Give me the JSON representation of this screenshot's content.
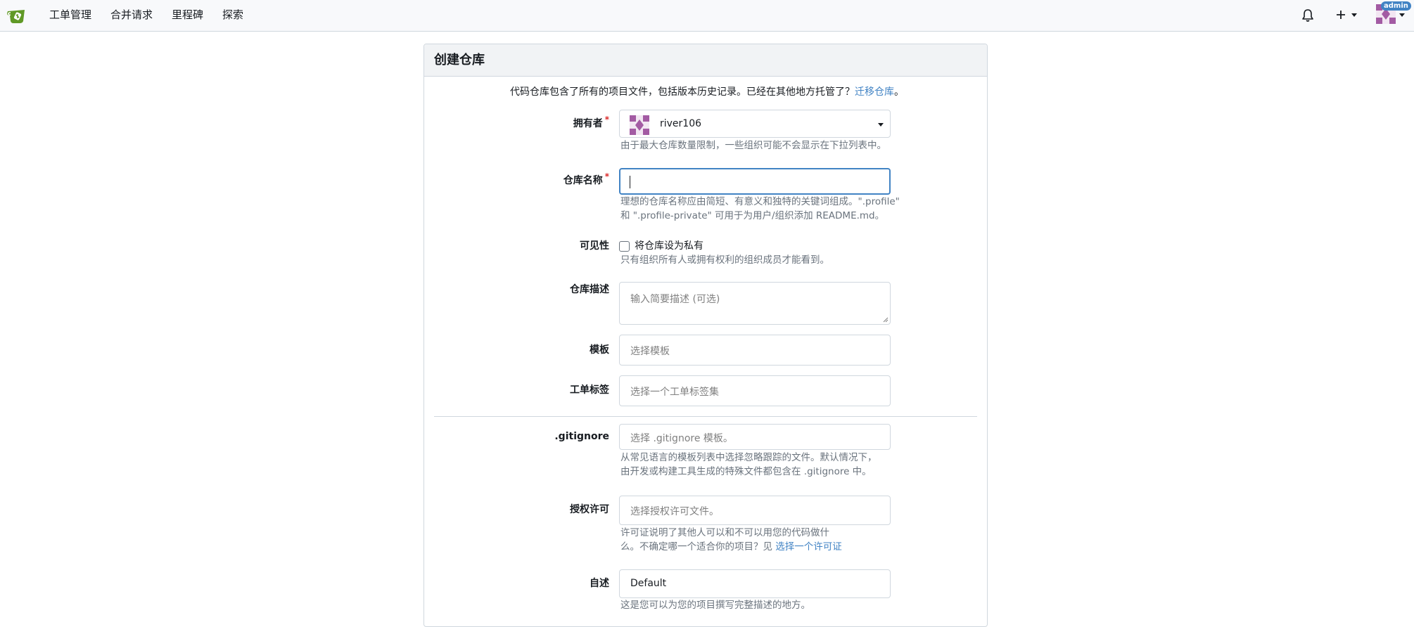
{
  "nav": {
    "items": [
      "工单管理",
      "合并请求",
      "里程碑",
      "探索"
    ],
    "admin_badge": "admin",
    "icons": [
      "bell-icon",
      "plus-icon",
      "avatar"
    ]
  },
  "card": {
    "title": "创建仓库",
    "intro_text": "代码仓库包含了所有的项目文件，包括版本历史记录。已经在其他地方托管了？",
    "intro_link": "迁移仓库",
    "intro_suffix": "。"
  },
  "form": {
    "owner": {
      "label": "拥有者",
      "value": "river106",
      "help": "由于最大仓库数量限制，一些组织可能不会显示在下拉列表中。"
    },
    "repo_name": {
      "label": "仓库名称",
      "value": "",
      "help_line1": "理想的仓库名称应由简短、有意义和独特的关键词组成。\".profile\"",
      "help_line2": "和 \".profile-private\" 可用于为用户/组织添加 README.md。"
    },
    "visibility": {
      "label": "可见性",
      "checkbox_label": "将仓库设为私有",
      "checked": false,
      "help": "只有组织所有人或拥有权利的组织成员才能看到。"
    },
    "description": {
      "label": "仓库描述",
      "placeholder": "输入简要描述 (可选)"
    },
    "template": {
      "label": "模板",
      "placeholder": "选择模板"
    },
    "issue_labels": {
      "label": "工单标签",
      "placeholder": "选择一个工单标签集"
    },
    "gitignore": {
      "label": ".gitignore",
      "placeholder": "选择 .gitignore 模板。",
      "help_line1": "从常见语言的模板列表中选择忽略跟踪的文件。默认情况下，",
      "help_line2": "由开发或构建工具生成的特殊文件都包含在 .gitignore 中。"
    },
    "license": {
      "label": "授权许可",
      "placeholder": "选择授权许可文件。",
      "help_line1": "许可证说明了其他人可以和不可以用您的代码做什",
      "help_line2": "么。不确定哪一个适合你的项目？见 ",
      "help_link": "选择一个许可证"
    },
    "readme": {
      "label": "自述",
      "value": "Default",
      "help": "这是您可以为您的项目撰写完整描述的地方。"
    }
  },
  "colors": {
    "accent": "#4183c4",
    "required": "#db2828",
    "navbar_bg": "#f8f9fb",
    "avatar": "#a35ba3"
  }
}
